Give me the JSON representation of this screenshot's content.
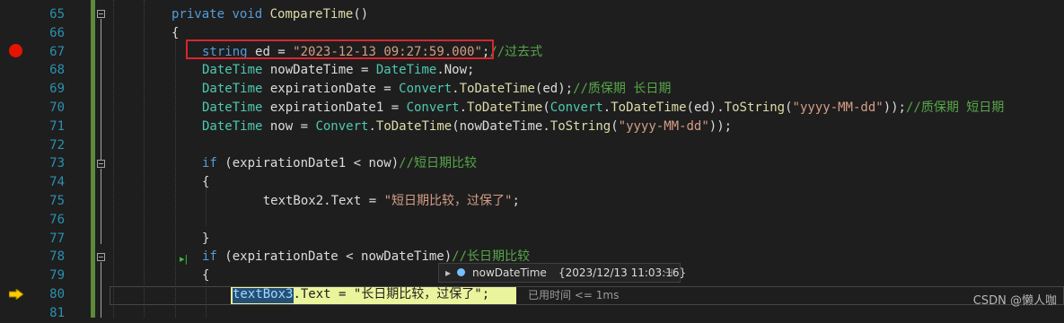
{
  "editor": {
    "lines": [
      {
        "n": "65",
        "tokens": [
          [
            "kw",
            "private "
          ],
          [
            "kw",
            "void "
          ],
          [
            "mt",
            "CompareTime"
          ],
          [
            "pl",
            "()"
          ]
        ]
      },
      {
        "n": "66",
        "tokens": [
          [
            "pl",
            "{"
          ]
        ]
      },
      {
        "n": "67",
        "tokens": [
          [
            "kw",
            "string "
          ],
          [
            "pl",
            "ed = "
          ],
          [
            "st",
            "\"2023-12-13 09:27:59.000\""
          ],
          [
            "pl",
            ";"
          ],
          [
            "cm",
            "//过去式"
          ]
        ]
      },
      {
        "n": "68",
        "tokens": [
          [
            "ty",
            "DateTime "
          ],
          [
            "pl",
            "nowDateTime = "
          ],
          [
            "ty",
            "DateTime"
          ],
          [
            "pl",
            "."
          ],
          [
            "pl",
            "Now;"
          ]
        ]
      },
      {
        "n": "69",
        "tokens": [
          [
            "ty",
            "DateTime "
          ],
          [
            "pl",
            "expirationDate = "
          ],
          [
            "ty",
            "Convert"
          ],
          [
            "pl",
            "."
          ],
          [
            "mt",
            "ToDateTime"
          ],
          [
            "pl",
            "(ed);"
          ],
          [
            "cm",
            "//质保期 长日期"
          ]
        ]
      },
      {
        "n": "70",
        "tokens": [
          [
            "ty",
            "DateTime "
          ],
          [
            "pl",
            "expirationDate1 = "
          ],
          [
            "ty",
            "Convert"
          ],
          [
            "pl",
            "."
          ],
          [
            "mt",
            "ToDateTime"
          ],
          [
            "pl",
            "("
          ],
          [
            "ty",
            "Convert"
          ],
          [
            "pl",
            "."
          ],
          [
            "mt",
            "ToDateTime"
          ],
          [
            "pl",
            "(ed)."
          ],
          [
            "mt",
            "ToString"
          ],
          [
            "pl",
            "("
          ],
          [
            "st",
            "\"yyyy-MM-dd\""
          ],
          [
            "pl",
            "));"
          ],
          [
            "cm",
            "//质保期 短日期"
          ]
        ]
      },
      {
        "n": "71",
        "tokens": [
          [
            "ty",
            "DateTime "
          ],
          [
            "pl",
            "now = "
          ],
          [
            "ty",
            "Convert"
          ],
          [
            "pl",
            "."
          ],
          [
            "mt",
            "ToDateTime"
          ],
          [
            "pl",
            "(nowDateTime."
          ],
          [
            "mt",
            "ToString"
          ],
          [
            "pl",
            "("
          ],
          [
            "st",
            "\"yyyy-MM-dd\""
          ],
          [
            "pl",
            "));"
          ]
        ]
      },
      {
        "n": "72",
        "tokens": []
      },
      {
        "n": "73",
        "tokens": [
          [
            "kw",
            "if "
          ],
          [
            "pl",
            "(expirationDate1 < now)"
          ],
          [
            "cm",
            "//短日期比较"
          ]
        ]
      },
      {
        "n": "74",
        "tokens": [
          [
            "pl",
            "{"
          ]
        ]
      },
      {
        "n": "75",
        "tokens": [
          [
            "pl",
            "    textBox2.Text = "
          ],
          [
            "st",
            "\"短日期比较，过保了\""
          ],
          [
            "pl",
            ";"
          ]
        ]
      },
      {
        "n": "76",
        "tokens": []
      },
      {
        "n": "77",
        "tokens": [
          [
            "pl",
            "}"
          ]
        ]
      },
      {
        "n": "78",
        "tokens": [
          [
            "kw",
            "if "
          ],
          [
            "pl",
            "(expirationDate < nowDateTime)"
          ],
          [
            "cm",
            "//长日期比较"
          ]
        ]
      },
      {
        "n": "79",
        "tokens": [
          [
            "pl",
            "{"
          ]
        ]
      },
      {
        "n": "80",
        "tokens": [
          [
            "sel",
            "textBox3"
          ],
          [
            "pl",
            ".Text = "
          ],
          [
            "pl",
            "\"长日期比较，过保了\""
          ],
          [
            "pl",
            ";"
          ]
        ]
      },
      {
        "n": "81",
        "tokens": []
      }
    ],
    "elapsed_label": "已用时间 <= 1ms"
  },
  "datatip": {
    "expand_glyph": "▸",
    "name": "nowDateTime",
    "value": "{2023/12/13 11:03:16}",
    "pin_glyph": "⊣"
  },
  "run_to_glyph": "▸|",
  "watermark": "CSDN @懒人咖",
  "colors": {
    "keyword": "#569cd6",
    "type": "#4ec9b0",
    "method": "#dcdcaa",
    "string": "#d69d85",
    "comment": "#57a64a",
    "line_number": "#2b91af",
    "breakpoint": "#e51400",
    "exec_highlight": "#eaf49c",
    "annotation_box": "#d9262c"
  }
}
